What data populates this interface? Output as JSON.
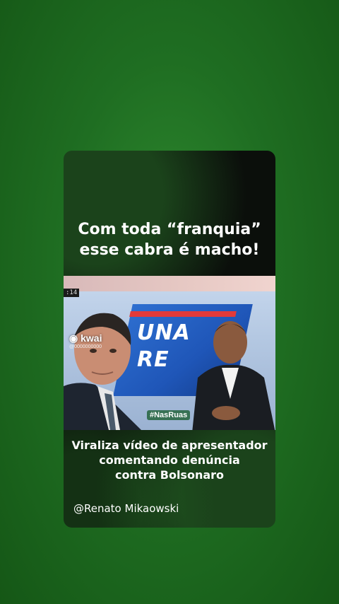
{
  "post": {
    "headline": "Com toda “franquia”\nesse cabra é macho!",
    "caption": "Viraliza vídeo de apresentador\ncomentando denúncia\ncontra Bolsonaro",
    "author_handle": "@Renato Mikaowski"
  },
  "video": {
    "timecode": ":14",
    "show_title": "UNA\nRE",
    "watermark_brand": "kwai",
    "watermark_id": "@0000000000",
    "corner_logo": "#NasRuas"
  },
  "colors": {
    "background": "#1f6e22",
    "card": "#0b0f0b",
    "text": "#ffffff"
  },
  "icons": [
    "kwai-logo-icon",
    "nasruas-logo-icon"
  ]
}
